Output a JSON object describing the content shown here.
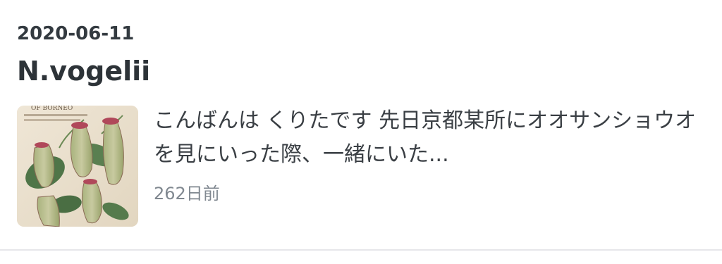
{
  "entry": {
    "date": "2020-06-11",
    "title": "N.vogelii",
    "excerpt": "こんばんは くりたです 先日京都某所にオオサンショウオを見にいった際、一緒にいた...",
    "relative_time": "262日前",
    "thumbnail": {
      "icon": "pitcher-plant-illustration-image",
      "caption_text": "OF BORNEO"
    }
  },
  "colors": {
    "text_primary": "#2d3338",
    "text_secondary": "#808890",
    "divider": "#e6e6ea"
  }
}
